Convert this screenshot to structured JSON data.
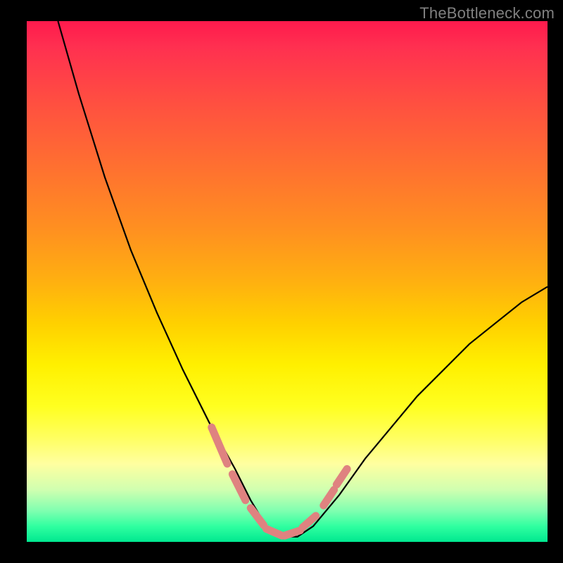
{
  "watermark": "TheBottleneck.com",
  "chart_data": {
    "type": "line",
    "title": "",
    "xlabel": "",
    "ylabel": "",
    "xlim": [
      0,
      100
    ],
    "ylim": [
      0,
      100
    ],
    "gradient_meaning": "red=high bottleneck, green=low bottleneck",
    "series": [
      {
        "name": "bottleneck-curve",
        "color": "#000000",
        "x": [
          6,
          10,
          15,
          20,
          25,
          30,
          35,
          40,
          43,
          46,
          49,
          52,
          55,
          60,
          65,
          70,
          75,
          80,
          85,
          90,
          95,
          100
        ],
        "y": [
          100,
          86,
          70,
          56,
          44,
          33,
          23,
          14,
          8,
          3,
          1,
          1,
          3,
          9,
          16,
          22,
          28,
          33,
          38,
          42,
          46,
          49
        ]
      },
      {
        "name": "highlight-dashes",
        "color": "#e08080",
        "segments": [
          {
            "x": [
              35.5,
              38.5
            ],
            "y": [
              22,
              15
            ]
          },
          {
            "x": [
              39.5,
              42
            ],
            "y": [
              13,
              8
            ]
          },
          {
            "x": [
              43,
              45.5
            ],
            "y": [
              6.5,
              3.2
            ]
          },
          {
            "x": [
              46,
              49
            ],
            "y": [
              2.5,
              1.2
            ]
          },
          {
            "x": [
              49.5,
              52.5
            ],
            "y": [
              1.2,
              2.2
            ]
          },
          {
            "x": [
              53,
              55.5
            ],
            "y": [
              2.8,
              5
            ]
          },
          {
            "x": [
              57,
              59
            ],
            "y": [
              7,
              10
            ]
          },
          {
            "x": [
              59.5,
              61.5
            ],
            "y": [
              11,
              14
            ]
          }
        ]
      }
    ]
  }
}
